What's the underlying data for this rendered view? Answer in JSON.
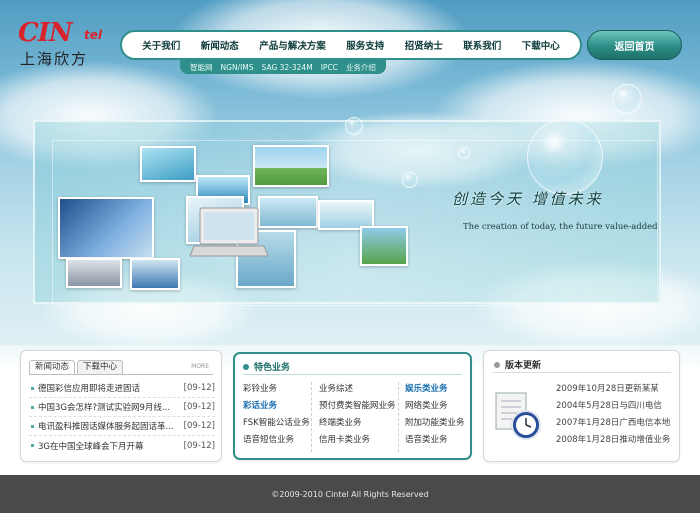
{
  "logo": {
    "brand": "CIN",
    "brand_suffix": "tel",
    "chinese": "上海欣方"
  },
  "nav": {
    "items": [
      "关于我们",
      "新闻动态",
      "产品与解决方案",
      "服务支持",
      "招贤纳士",
      "联系我们",
      "下载中心"
    ],
    "home_button": "返回首页"
  },
  "subnav": {
    "items": [
      "智能网",
      "NGN/IMS",
      "SAG 32-324M",
      "IPCC",
      "业务介绍"
    ]
  },
  "hero": {
    "slogan_cn": "创造今天  增值未来",
    "slogan_en": "The creation of today, the future value-added"
  },
  "news": {
    "tabs": [
      "新闻动态",
      "下载中心"
    ],
    "more": "MORE",
    "items": [
      {
        "title": "德国彩信应用即将走进固话",
        "date": "[09-12]"
      },
      {
        "title": "中国3G会怎样?测试实验网9月线...",
        "date": "[09-12]"
      },
      {
        "title": "电讯盈科推固话媒体服务起固话革...",
        "date": "[09-12]"
      },
      {
        "title": "3G在中国全球峰会下月开幕",
        "date": "[09-12]"
      }
    ]
  },
  "feature": {
    "title": "特色业务",
    "col1": [
      "彩铃业务",
      "彩话业务",
      "FSK智能公话业务",
      "语音短信业务"
    ],
    "col2": [
      "业务综述",
      "预付费类智能网业务",
      "终端类业务",
      "信用卡类业务"
    ],
    "col3": [
      "娱乐类业务",
      "网络类业务",
      "附加功能类业务",
      "语音类业务"
    ]
  },
  "version": {
    "title": "版本更新",
    "items": [
      "2009年10月28日更新某某",
      "2004年5月28日与四川电信",
      "2007年1月28日广西电信本地",
      "2008年1月28日推动增值业务"
    ]
  },
  "footer": {
    "copyright": "©2009-2010 Cintel All Rights Reserved"
  },
  "colors": {
    "accent": "#2f8f8a",
    "brand_red": "#d8232a",
    "link_blue": "#1a6fb0",
    "footer_bg": "#4a4a4a"
  }
}
